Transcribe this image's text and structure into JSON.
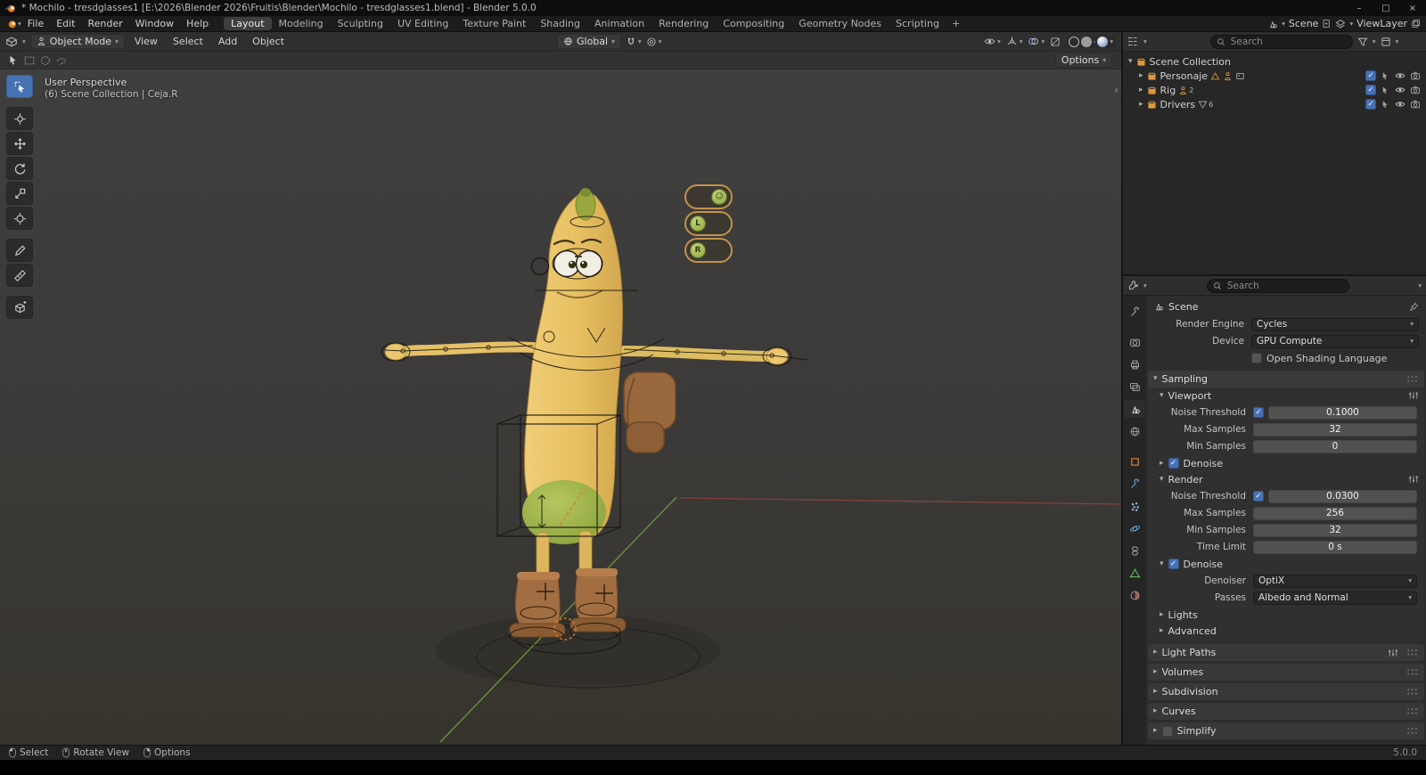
{
  "icons": {
    "chevron_down": "▾",
    "chevron_right": "▸",
    "check": "✓",
    "minimize": "–",
    "maximize": "□",
    "close": "×",
    "add": "+",
    "collapse_panel": "‹"
  },
  "titlebar": {
    "title": "* Mochilo - tresdglasses1 [E:\\2026\\Blender 2026\\Fruitis\\Blender\\Mochilo - tresdglasses1.blend] - Blender 5.0.0"
  },
  "menubar": {
    "menus": [
      {
        "label": "File"
      },
      {
        "label": "Edit"
      },
      {
        "label": "Render"
      },
      {
        "label": "Window"
      },
      {
        "label": "Help"
      }
    ],
    "workspaces": [
      {
        "label": "Layout"
      },
      {
        "label": "Modeling"
      },
      {
        "label": "Sculpting"
      },
      {
        "label": "UV Editing"
      },
      {
        "label": "Texture Paint"
      },
      {
        "label": "Shading"
      },
      {
        "label": "Animation"
      },
      {
        "label": "Rendering"
      },
      {
        "label": "Compositing"
      },
      {
        "label": "Geometry Nodes"
      },
      {
        "label": "Scripting"
      }
    ],
    "active_workspace": "Layout",
    "add_tab": "+",
    "scene_name": "Scene",
    "viewlayer_name": "ViewLayer"
  },
  "viewport": {
    "header": {
      "mode": "Object Mode",
      "menus": [
        {
          "label": "View"
        },
        {
          "label": "Select"
        },
        {
          "label": "Add"
        },
        {
          "label": "Object"
        }
      ],
      "orientation": "Global"
    },
    "tool_settings": {
      "options": "Options"
    },
    "overlay": {
      "view_name": "User Perspective",
      "context_path": "(6) Scene Collection | Ceja.R"
    },
    "toolbar_tools": [
      "tweak-select",
      "cursor-3d",
      "move",
      "rotate",
      "scale",
      "transform",
      "annotate",
      "measure",
      "add-primitive"
    ],
    "active_tool": "tweak-select",
    "rig_pickers": [
      {
        "label": "☺"
      },
      {
        "label": "L"
      },
      {
        "label": "R"
      }
    ],
    "axis_colors": {
      "x": "#a8443f",
      "y": "#6e9b3d"
    }
  },
  "outliner": {
    "search_placeholder": "Search",
    "rows": [
      {
        "label": "Scene Collection",
        "badge": ""
      },
      {
        "label": "Personaje",
        "badge": ""
      },
      {
        "label": "Rig",
        "badge": "2"
      },
      {
        "label": "Drivers",
        "badge": "6"
      }
    ]
  },
  "properties": {
    "search_placeholder": "Search",
    "breadcrumb": "Scene",
    "tabs": [
      "tool",
      "render",
      "output",
      "view-layer",
      "scene",
      "world",
      "object",
      "modifiers",
      "particles",
      "physics",
      "constraints",
      "object-data",
      "material"
    ],
    "active_tab": "scene",
    "render_engine": {
      "label": "Render Engine",
      "value": "Cycles"
    },
    "device": {
      "label": "Device",
      "value": "GPU Compute"
    },
    "osl": {
      "label": "Open Shading Language",
      "checked": false
    },
    "sampling": {
      "title": "Sampling",
      "viewport": {
        "title": "Viewport",
        "noise_threshold": {
          "label": "Noise Threshold",
          "value": "0.1000",
          "checked": true
        },
        "max_samples": {
          "label": "Max Samples",
          "value": "32"
        },
        "min_samples": {
          "label": "Min Samples",
          "value": "0"
        },
        "denoise": {
          "label": "Denoise",
          "checked": true
        }
      },
      "render": {
        "title": "Render",
        "noise_threshold": {
          "label": "Noise Threshold",
          "value": "0.0300",
          "checked": true
        },
        "max_samples": {
          "label": "Max Samples",
          "value": "256"
        },
        "min_samples": {
          "label": "Min Samples",
          "value": "32"
        },
        "time_limit": {
          "label": "Time Limit",
          "value": "0 s"
        },
        "denoise": {
          "label": "Denoise",
          "checked": true,
          "denoiser": {
            "label": "Denoiser",
            "value": "OptiX"
          },
          "passes": {
            "label": "Passes",
            "value": "Albedo and Normal"
          }
        }
      },
      "lights_title": "Lights",
      "advanced_title": "Advanced"
    },
    "panels": [
      {
        "title": "Light Paths"
      },
      {
        "title": "Volumes"
      },
      {
        "title": "Subdivision"
      },
      {
        "title": "Curves"
      },
      {
        "title": "Simplify"
      }
    ]
  },
  "statusbar": {
    "hints": [
      {
        "label": "Select"
      },
      {
        "label": "Rotate View"
      },
      {
        "label": "Options"
      }
    ],
    "version": "5.0.0"
  }
}
